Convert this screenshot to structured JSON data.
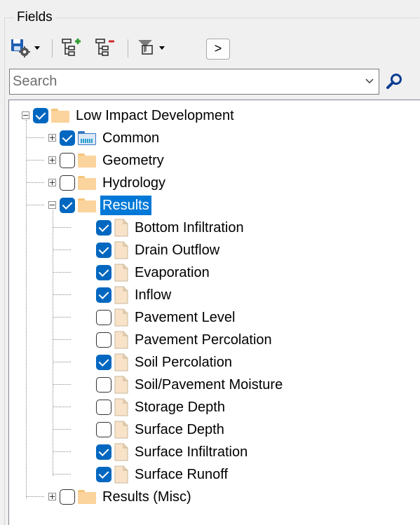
{
  "panel": {
    "title": "Fields"
  },
  "toolbar": {
    "expand_label": ">"
  },
  "search": {
    "placeholder": "Search",
    "value": ""
  },
  "tree": {
    "root": {
      "label": "Low Impact Development",
      "checked": true,
      "expanded": true
    },
    "groups": [
      {
        "label": "Common",
        "checked": true,
        "expanded": false,
        "icon": "folder-teal-icon"
      },
      {
        "label": "Geometry",
        "checked": false,
        "expanded": false,
        "icon": "folder-icon"
      },
      {
        "label": "Hydrology",
        "checked": false,
        "expanded": false,
        "icon": "folder-icon"
      },
      {
        "label": "Results",
        "checked": true,
        "expanded": true,
        "selected": true,
        "icon": "folder-icon"
      },
      {
        "label": "Results (Misc)",
        "checked": false,
        "expanded": false,
        "icon": "folder-icon"
      }
    ],
    "results_items": [
      {
        "label": "Bottom Infiltration",
        "checked": true
      },
      {
        "label": "Drain Outflow",
        "checked": true
      },
      {
        "label": "Evaporation",
        "checked": true
      },
      {
        "label": "Inflow",
        "checked": true
      },
      {
        "label": "Pavement Level",
        "checked": false
      },
      {
        "label": "Pavement Percolation",
        "checked": false
      },
      {
        "label": "Soil Percolation",
        "checked": true
      },
      {
        "label": "Soil/Pavement Moisture",
        "checked": false
      },
      {
        "label": "Storage Depth",
        "checked": false
      },
      {
        "label": "Surface Depth",
        "checked": false
      },
      {
        "label": "Surface Infiltration",
        "checked": true
      },
      {
        "label": "Surface Runoff",
        "checked": true
      }
    ]
  },
  "colors": {
    "accent": "#0067c0",
    "selection": "#0078d7",
    "folder": "#fbd39c"
  }
}
